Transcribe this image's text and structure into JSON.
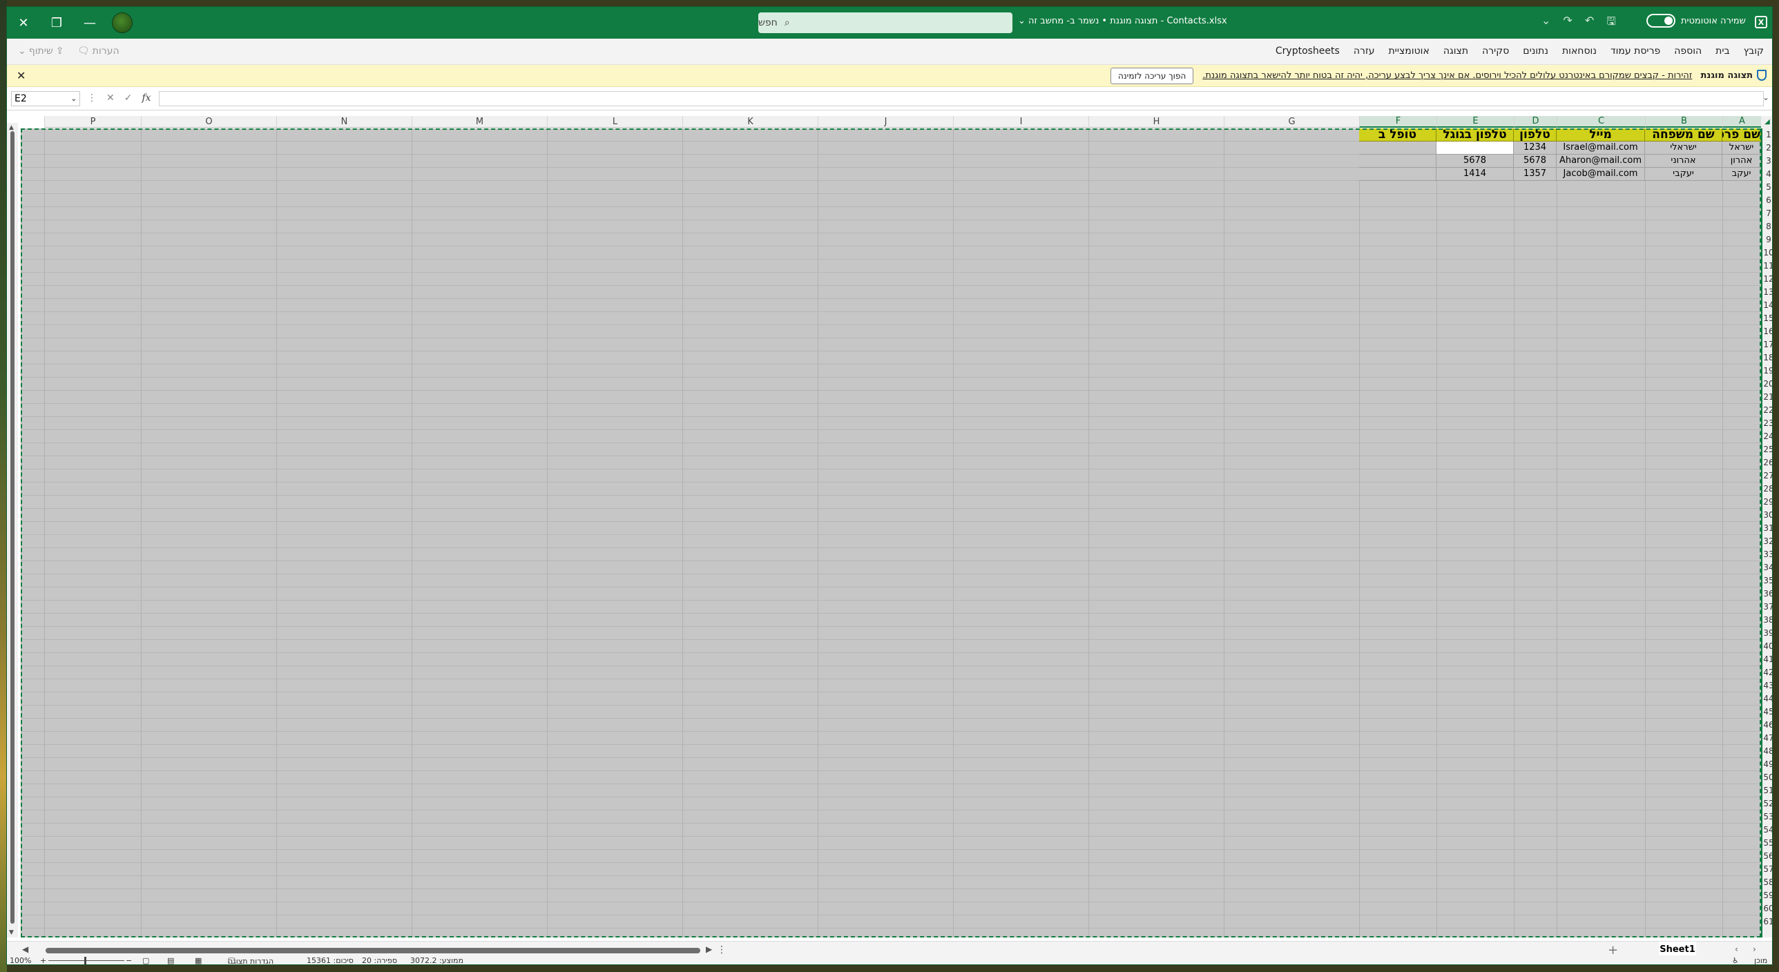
{
  "window": {
    "filename": "Contacts.xlsx",
    "title_suffix": "תצוגה מוגנת • נשמר ב- מחשב זה",
    "autosave_label": "שמירה אוטומטית",
    "search_placeholder": "חפש"
  },
  "menu": {
    "tabs": [
      "קובץ",
      "בית",
      "הוספה",
      "פריסת עמוד",
      "נוסחאות",
      "נתונים",
      "סקירה",
      "תצוגה",
      "אוטומציית",
      "עזרה",
      "Cryptosheets"
    ],
    "comments_label": "הערות",
    "share_label": "שיתוף"
  },
  "protected_view": {
    "title": "תצוגה מוגנת",
    "message": "זהירות - קבצים שמקורם באינטרנט עלולים להכיל וירוסים. אם אינך צריך לבצע עריכה, יהיה זה בטוח יותר להישאר בתצוגה מוגנת.",
    "enable_button": "הפוך עריכה לזמינה"
  },
  "formula_bar": {
    "name_box": "E2",
    "fx_label": "fx",
    "formula": ""
  },
  "columns": [
    "A",
    "B",
    "C",
    "D",
    "E",
    "F",
    "G",
    "H",
    "I",
    "J",
    "K",
    "L",
    "M",
    "N",
    "O",
    "P"
  ],
  "rows_visible": 61,
  "table": {
    "headers": [
      "שם פרטי",
      "שם משפחה",
      "מייל",
      "טלפון",
      "טלפון בגוגל",
      "טופל ב"
    ],
    "rows": [
      [
        "ישראל",
        "ישראלי",
        "Israel@mail.com",
        "1234",
        "",
        ""
      ],
      [
        "אהרון",
        "אהרוני",
        "Aharon@mail.com",
        "5678",
        "5678",
        ""
      ],
      [
        "יעקב",
        "יעקבי",
        "Jacob@mail.com",
        "1357",
        "1414",
        ""
      ]
    ]
  },
  "sheets": [
    "Sheet1"
  ],
  "status_bar": {
    "ready": "מוכן",
    "average": "ממוצע: 3072.2",
    "count": "ספירה: 20",
    "sum": "סיכום: 15361",
    "display_settings": "הגדרות תצוגה",
    "zoom": "100%"
  },
  "colors": {
    "titlebar": "#107c41",
    "header_fill": "#cfd11a",
    "grey_fill": "#c6c6c6",
    "protected_bar": "#fdf6c7"
  }
}
